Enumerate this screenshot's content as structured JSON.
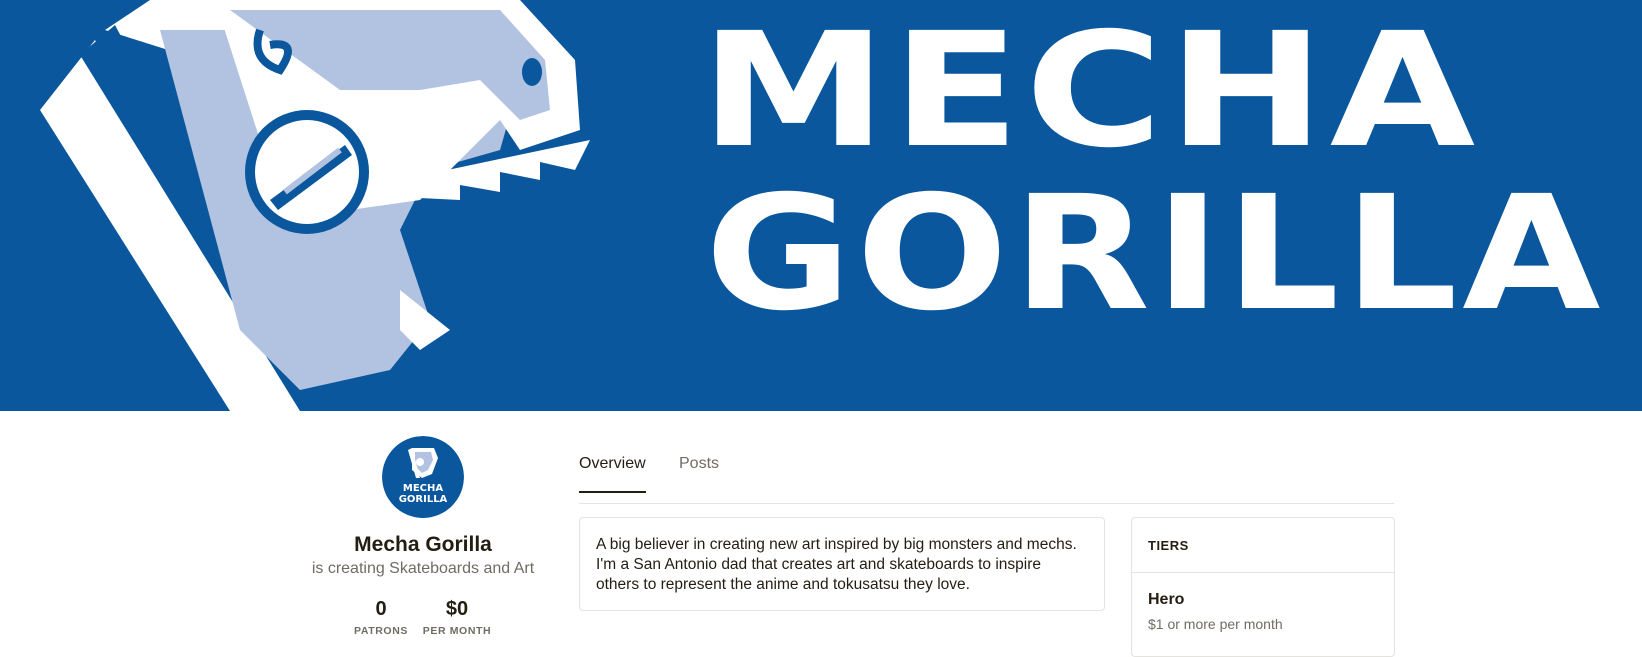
{
  "banner": {
    "logo_line1": "MECHA",
    "logo_line2": "GORILLA",
    "background_color": "#0a579e",
    "icon": "mecha-gorilla-head-icon"
  },
  "creator": {
    "avatar_line1": "MECHA",
    "avatar_line2": "GORILLA",
    "name": "Mecha Gorilla",
    "tagline": "is creating Skateboards and Art"
  },
  "stats": {
    "patrons_value": "0",
    "patrons_label": "PATRONS",
    "monthly_value": "$0",
    "monthly_label": "PER MONTH"
  },
  "tabs": [
    {
      "label": "Overview",
      "active": true
    },
    {
      "label": "Posts",
      "active": false
    }
  ],
  "about": {
    "text": "A big believer in creating new art inspired by big monsters and mechs. I'm a San Antonio dad that creates art and skateboards to inspire others to represent the anime and tokusatsu they love."
  },
  "tiers": {
    "heading": "TIERS",
    "items": [
      {
        "name": "Hero",
        "price": "$1 or more per month"
      }
    ]
  }
}
